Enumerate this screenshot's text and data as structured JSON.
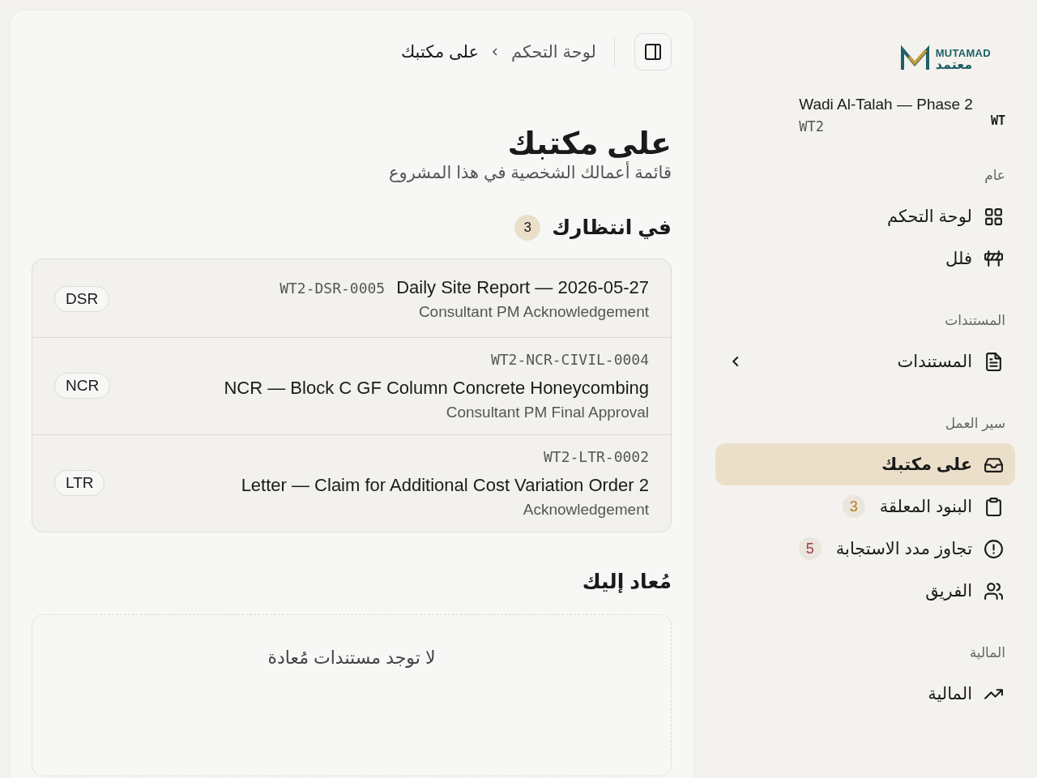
{
  "brand": {
    "latin": "MUTAMAD",
    "arabic": "معتمد"
  },
  "project": {
    "name": "Wadi Al-Talah — Phase 2",
    "code": "WT2",
    "initials": "WT"
  },
  "sidebar": {
    "sections": [
      {
        "title": "عام",
        "items": [
          {
            "label": "لوحة التحكم",
            "selected": false
          },
          {
            "label": "فلل",
            "selected": false
          }
        ]
      },
      {
        "title": "المستندات",
        "items": [
          {
            "label": "المستندات",
            "selected": false,
            "expanded": false
          }
        ]
      },
      {
        "title": "سير العمل",
        "items": [
          {
            "label": "على مكتبك",
            "selected": true
          },
          {
            "label": "البنود المعلقة",
            "selected": false,
            "badge": "3",
            "color": "#b87a1c"
          },
          {
            "label": "تجاوز مدد الاستجابة",
            "selected": false,
            "badge": "5",
            "color": "#9b3a4a"
          },
          {
            "label": "الفريق",
            "selected": false
          }
        ]
      },
      {
        "title": "المالية",
        "items": [
          {
            "label": "المالية",
            "selected": false
          }
        ]
      }
    ]
  },
  "breadcrumb": [
    "لوحة التحكم",
    "على مكتبك"
  ],
  "page": {
    "title": "على مكتبك",
    "subtitle": "قائمة أعمالك الشخصية في هذا المشروع"
  },
  "waiting": {
    "title": "في انتظارك",
    "count": "3",
    "items": [
      {
        "title": "Daily Site Report — 2026-05-27",
        "code": "WT2-DSR-0005",
        "step": "Consultant PM Acknowledgement",
        "tag": "DSR"
      },
      {
        "title": "NCR — Block C GF Column Concrete Honeycombing",
        "code": "WT2-NCR-CIVIL-0004",
        "step": "Consultant PM Final Approval",
        "tag": "NCR"
      },
      {
        "title": "Letter — Claim for Additional Cost Variation Order 2",
        "code": "WT2-LTR-0002",
        "step": "Acknowledgement",
        "tag": "LTR"
      }
    ]
  },
  "returned": {
    "title": "مُعاد إليك",
    "empty_title": "لا توجد مستندات مُعادة"
  }
}
